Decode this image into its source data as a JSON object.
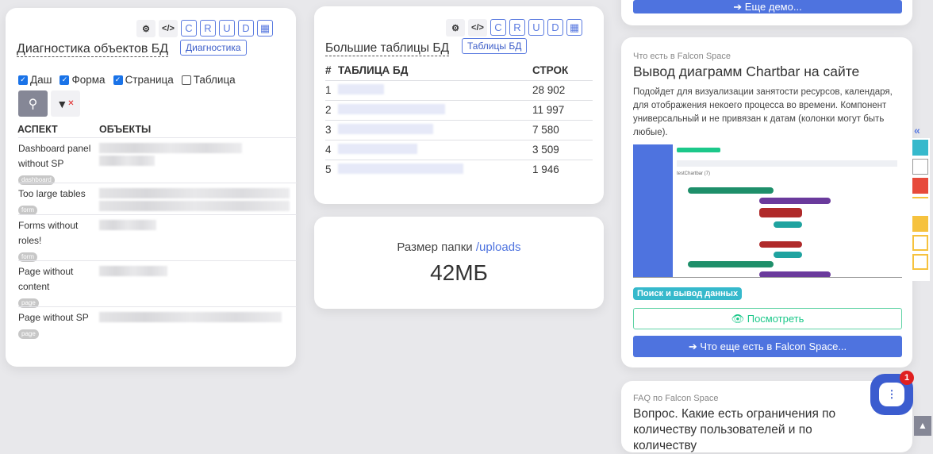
{
  "diag": {
    "title": "Диагностика объектов БД",
    "tag": "Диагностика",
    "toolbar": [
      "C",
      "R",
      "U",
      "D"
    ],
    "checks": [
      {
        "label": "Даш",
        "checked": true
      },
      {
        "label": "Форма",
        "checked": true
      },
      {
        "label": "Страница",
        "checked": true
      },
      {
        "label": "Таблица",
        "checked": false
      }
    ],
    "col_aspect": "АСПЕКТ",
    "col_objects": "ОБЪЕКТЫ",
    "rows": [
      {
        "aspect": "Dashboard panel without SP",
        "type": "dashboard"
      },
      {
        "aspect": "Too large tables",
        "type": "form"
      },
      {
        "aspect": "Forms without roles!",
        "type": "form"
      },
      {
        "aspect": "Page without content",
        "type": "page"
      },
      {
        "aspect": "Page without SP",
        "type": "page"
      }
    ]
  },
  "big": {
    "title": "Большие таблицы БД",
    "tag": "Таблицы БД",
    "toolbar": [
      "C",
      "R",
      "U",
      "D"
    ],
    "col_num": "#",
    "col_table": "ТАБЛИЦА БД",
    "col_rows": "СТРОК",
    "rows": [
      {
        "n": "1",
        "rows": "28 902"
      },
      {
        "n": "2",
        "rows": "11 997"
      },
      {
        "n": "3",
        "rows": "7 580"
      },
      {
        "n": "4",
        "rows": "3 509"
      },
      {
        "n": "5",
        "rows": "1 946"
      }
    ]
  },
  "folder": {
    "label": "Размер папки ",
    "link": "/uploads",
    "size": "42МБ"
  },
  "demo": {
    "more_button": "➔ Еще демо..."
  },
  "feature": {
    "kicker": "Что есть в Falcon Space",
    "title": "Вывод диаграмм Chartbar на сайте",
    "desc": "Подойдет для визуализации занятости ресурсов, календаря, для отображения некоего процесса во времени. Компонент универсальный и не привязан к датам (колонки могут быть любые).",
    "chart_title": "testChartbar (7)",
    "badge": "Поиск и вывод данных",
    "view_button": "Посмотреть",
    "more_button": "➔ Что еще есть в Falcon Space..."
  },
  "faq": {
    "kicker": "FAQ по Falcon Space",
    "title": "Вопрос. Какие есть ограничения по количеству пользователей и по количеству"
  },
  "chat": {
    "badge": "1"
  },
  "colors": {
    "accent": "#4e73df",
    "teal": "#36b9cc",
    "green": "#1cc88a"
  }
}
